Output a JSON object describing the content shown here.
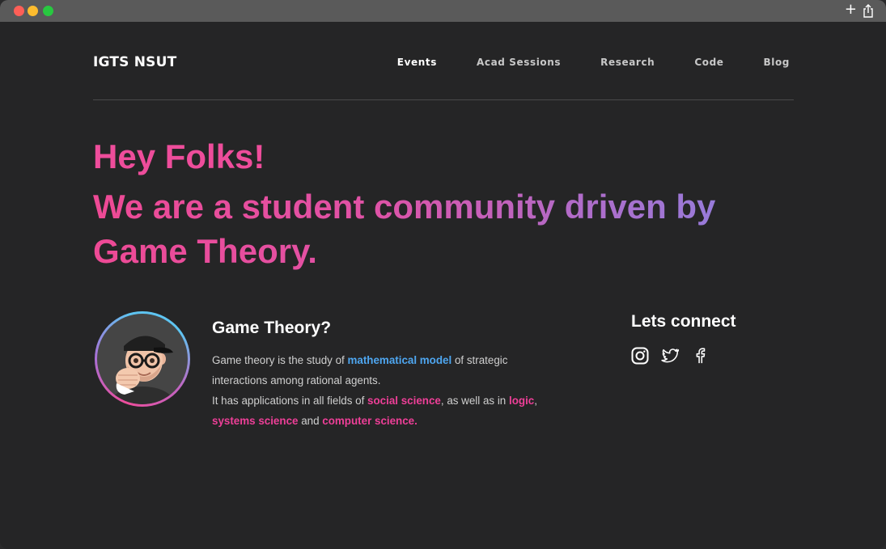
{
  "nav": {
    "brand": "IGTS NSUT",
    "links": [
      "Events",
      "Acad Sessions",
      "Research",
      "Code",
      "Blog"
    ]
  },
  "hero": {
    "greeting": "Hey Folks!",
    "tagline": "We are a student community driven by Game Theory."
  },
  "about": {
    "title": "Game Theory?",
    "p1_a": "Game theory is the study of ",
    "p1_link": "mathematical model",
    "p1_b": "  of strategic interactions among rational agents.",
    "p2_a": "It has applications in all fields of ",
    "p2_link1": "social science",
    "p2_b": ", as well as in ",
    "p2_link2": "logic",
    "p2_c": ", ",
    "p2_link3": "systems science",
    "p2_d": " and ",
    "p2_link4": "computer science."
  },
  "connect": {
    "title": "Lets connect",
    "socials": [
      "instagram-icon",
      "twitter-icon",
      "facebook-icon"
    ]
  },
  "colors": {
    "accent_pink": "#ee4d9b",
    "accent_blue": "#4ea6f0",
    "accent_purple": "#8a83e2",
    "background": "#252526"
  }
}
